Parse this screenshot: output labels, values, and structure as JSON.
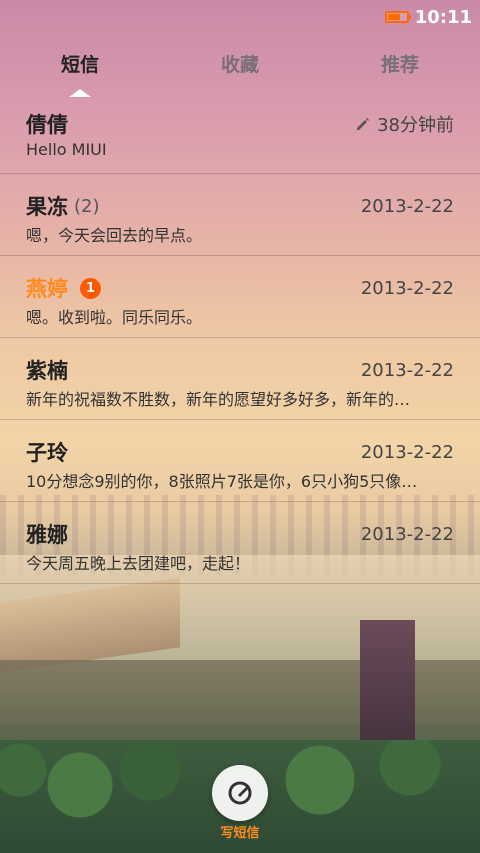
{
  "status": {
    "time": "10:11"
  },
  "tabs": [
    {
      "label": "短信"
    },
    {
      "label": "收藏"
    },
    {
      "label": "推荐"
    }
  ],
  "messages": [
    {
      "name": "倩倩",
      "count": "",
      "badge": "",
      "date": "38分钟前",
      "preview": "Hello MIUI",
      "unread": false
    },
    {
      "name": "果冻",
      "count": "(2)",
      "badge": "",
      "date": "2013-2-22",
      "preview": "嗯，今天会回去的早点。",
      "unread": false
    },
    {
      "name": "燕婷",
      "count": "",
      "badge": "1",
      "date": "2013-2-22",
      "preview": "嗯。收到啦。同乐同乐。",
      "unread": true
    },
    {
      "name": "紫楠",
      "count": "",
      "badge": "",
      "date": "2013-2-22",
      "preview": "新年的祝福数不胜数，新年的愿望好多好多，新年的…",
      "unread": false
    },
    {
      "name": "子玲",
      "count": "",
      "badge": "",
      "date": "2013-2-22",
      "preview": "10分想念9别的你，8张照片7张是你，6只小狗5只像…",
      "unread": false
    },
    {
      "name": "雅娜",
      "count": "",
      "badge": "",
      "date": "2013-2-22",
      "preview": "今天周五晚上去团建吧，走起！",
      "unread": false
    }
  ],
  "compose": {
    "label": "写短信"
  },
  "colors": {
    "unread": "#ff8a1f",
    "badge": "#ff5a00",
    "battery": "#ff6a00"
  }
}
